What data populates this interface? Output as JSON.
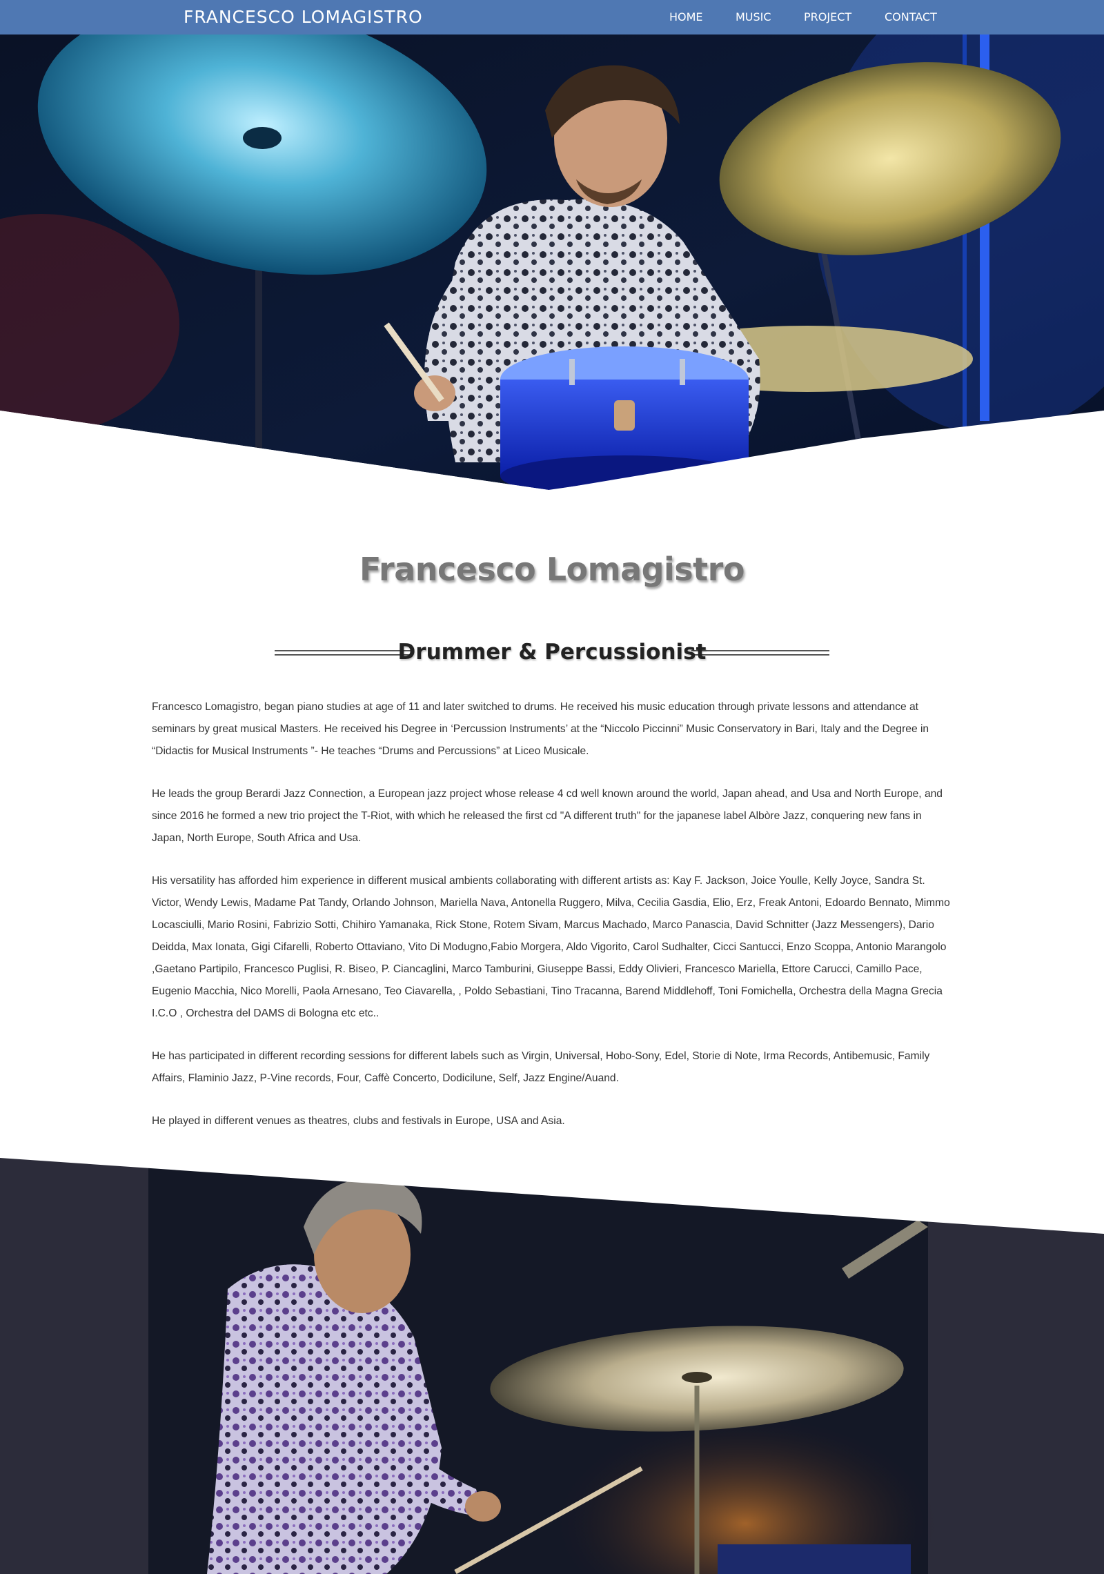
{
  "navbar": {
    "brand": "FRANCESCO LOMAGISTRO",
    "links": [
      {
        "label": "HOME"
      },
      {
        "label": "MUSIC"
      },
      {
        "label": "PROJECT"
      },
      {
        "label": "CONTACT"
      }
    ],
    "color": "#4f78b3"
  },
  "hero": {
    "image_description_icon": "drummer-photo"
  },
  "main": {
    "name": "Francesco Lomagistro",
    "subtitle": "Drummer & Percussionist",
    "paragraphs": [
      "Francesco Lomagistro, began piano studies at age of 11 and later switched to drums. He received his music education through private lessons and attendance at seminars by great musical Masters. He received his Degree in ‘Percussion Instruments’ at the “Niccolo Piccinni” Music Conservatory in Bari, Italy and the Degree in “Didactis for Musical Instruments ”- He teaches “Drums and Percussions” at Liceo Musicale.",
      "He leads the group Berardi Jazz Connection, a European jazz project whose release 4 cd well known around the world, Japan ahead, and Usa and North Europe, and since 2016 he formed a new trio project the T-Riot, with which he released the first cd \"A different truth\" for the japanese label Albòre Jazz, conquering new fans in Japan, North Europe, South Africa and Usa.",
      "His versatility has afforded him experience in different musical ambients collaborating with different artists as: Kay F. Jackson, Joice Youlle, Kelly Joyce, Sandra St. Victor, Wendy Lewis, Madame Pat Tandy, Orlando Johnson, Mariella Nava, Antonella Ruggero, Milva, Cecilia Gasdia, Elio, Erz, Freak Antoni, Edoardo Bennato, Mimmo Locasciulli, Mario Rosini, Fabrizio Sotti, Chihiro Yamanaka, Rick Stone, Rotem Sivam, Marcus Machado, Marco Panascia, David Schnitter (Jazz Messengers), Dario Deidda, Max Ionata, Gigi Cifarelli, Roberto Ottaviano, Vito Di Modugno,Fabio Morgera, Aldo Vigorito, Carol Sudhalter, Cicci Santucci, Enzo Scoppa, Antonio Marangolo ,Gaetano Partipilo, Francesco Puglisi, R. Biseo, P. Ciancaglini, Marco Tamburini, Giuseppe Bassi, Eddy Olivieri, Francesco Mariella, Ettore Carucci, Camillo Pace, Eugenio Macchia, Nico Morelli, Paola Arnesano, Teo Ciavarella, , Poldo Sebastiani, Tino Tracanna, Barend Middlehoff, Toni Fomichella, Orchestra della Magna Grecia I.C.O , Orchestra del DAMS di Bologna etc etc..",
      "He has participated in different recording sessions for different labels such as Virgin, Universal, Hobo-Sony, Edel, Storie di Note, Irma Records, Antibemusic, Family Affairs, Flaminio Jazz, P-Vine records, Four, Caffè Concerto, Dodicilune, Self, Jazz Engine/Auand.",
      "He played in different venues as theatres, clubs and festivals in Europe, USA and Asia."
    ]
  }
}
